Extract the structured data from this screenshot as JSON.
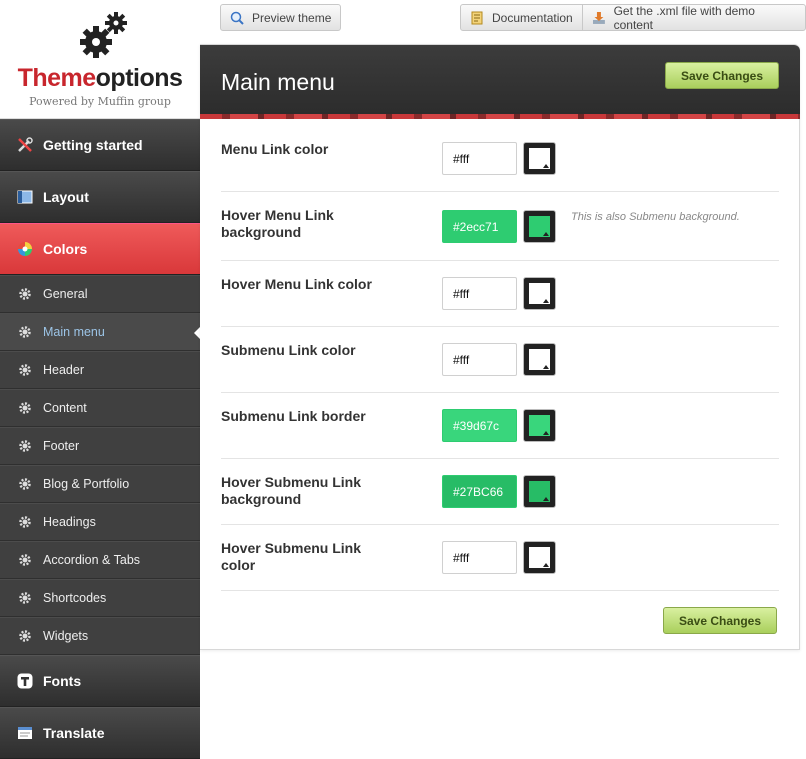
{
  "logo": {
    "title_red": "Theme",
    "title_dark": "options",
    "subtitle": "Powered by Muffin group"
  },
  "topbar": {
    "preview": "Preview theme",
    "documentation": "Documentation",
    "xml": "Get the .xml file with demo content"
  },
  "sidebar": {
    "main_items": {
      "getting_started": "Getting started",
      "layout": "Layout",
      "colors": "Colors",
      "fonts": "Fonts",
      "translate": "Translate"
    },
    "sub_items": [
      "General",
      "Main menu",
      "Header",
      "Content",
      "Footer",
      "Blog & Portfolio",
      "Headings",
      "Accordion & Tabs",
      "Shortcodes",
      "Widgets"
    ],
    "icons": [
      "tools-icon",
      "layout-icon",
      "color-wheel-icon",
      "gear-icon",
      "font-icon",
      "translate-icon"
    ]
  },
  "panel": {
    "title": "Main menu",
    "save_label": "Save Changes",
    "fields": [
      {
        "label": "Menu Link color",
        "value": "#fff",
        "swatch": "#ffffff"
      },
      {
        "label": "Hover Menu Link background",
        "value": "#2ecc71",
        "swatch": "#2ecc71",
        "note": "This is also Submenu background."
      },
      {
        "label": "Hover Menu Link color",
        "value": "#fff",
        "swatch": "#ffffff"
      },
      {
        "label": "Submenu Link color",
        "value": "#fff",
        "swatch": "#ffffff"
      },
      {
        "label": "Submenu Link border",
        "value": "#39d67c",
        "swatch": "#39d67c"
      },
      {
        "label": "Hover Submenu Link background",
        "value": "#27BC66",
        "swatch": "#27BC66"
      },
      {
        "label": "Hover Submenu Link color",
        "value": "#fff",
        "swatch": "#ffffff"
      }
    ]
  },
  "colors": {
    "accent_red": "#d9383a",
    "save_green": "#a9cf5c",
    "link_blue": "#9cc4e6"
  }
}
